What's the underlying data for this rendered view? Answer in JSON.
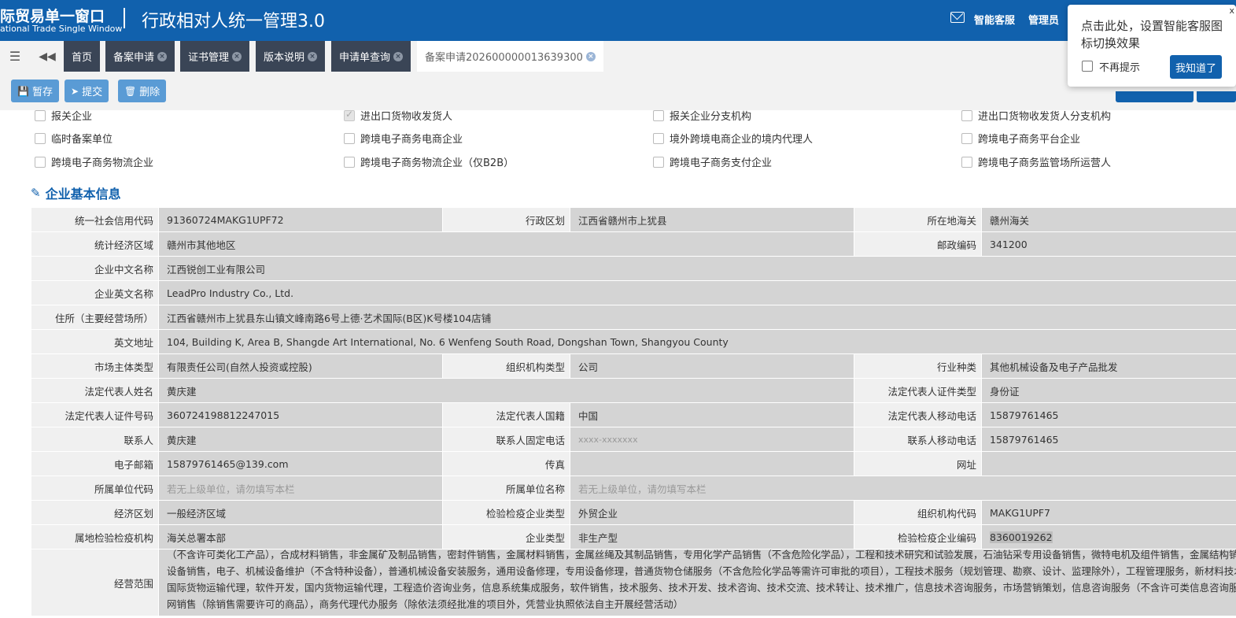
{
  "header": {
    "brand_cn": "际贸易单一窗口",
    "brand_en": "ational Trade Single Window",
    "system_title": "行政相对人统一管理3.0",
    "service_label": "智能客服",
    "admin_label": "管理员"
  },
  "popup": {
    "message": "点击此处，设置智能客服图标切换效果",
    "close": "x",
    "dont_show": "不再提示",
    "ok": "我知道了"
  },
  "tabs": {
    "home": "首页",
    "items": [
      "备案申请",
      "证书管理",
      "版本说明",
      "申请单查询"
    ],
    "active": "备案申请202600000013639300",
    "close_glyph": "×"
  },
  "toolbar": {
    "save": "暂存",
    "submit": "提交",
    "delete": "删除"
  },
  "enterprise_types": [
    {
      "label": "报关企业",
      "checked": false
    },
    {
      "label": "进出口货物收发货人",
      "checked": true
    },
    {
      "label": "报关企业分支机构",
      "checked": false
    },
    {
      "label": "进出口货物收发货人分支机构",
      "checked": false
    },
    {
      "label": "临时备案单位",
      "checked": false
    },
    {
      "label": "跨境电子商务电商企业",
      "checked": false
    },
    {
      "label": "境外跨境电商企业的境内代理人",
      "checked": false
    },
    {
      "label": "跨境电子商务平台企业",
      "checked": false
    },
    {
      "label": "跨境电子商务物流企业",
      "checked": false
    },
    {
      "label": "跨境电子商务物流企业（仅B2B）",
      "checked": false
    },
    {
      "label": "跨境电子商务支付企业",
      "checked": false
    },
    {
      "label": "跨境电子商务监管场所运营人",
      "checked": false
    }
  ],
  "section_title": "企业基本信息",
  "form": {
    "credit_code": {
      "label": "统一社会信用代码",
      "value": "91360724MAKG1UPF72"
    },
    "admin_region": {
      "label": "行政区划",
      "value": "江西省赣州市上犹县"
    },
    "customs": {
      "label": "所在地海关",
      "value": "赣州海关"
    },
    "econ_area": {
      "label": "统计经济区域",
      "value": "赣州市其他地区"
    },
    "postcode": {
      "label": "邮政编码",
      "value": "341200"
    },
    "name_cn": {
      "label": "企业中文名称",
      "value": "江西锐创工业有限公司"
    },
    "name_en": {
      "label": "企业英文名称",
      "value": "LeadPro Industry Co., Ltd."
    },
    "address": {
      "label": "住所（主要经营场所）",
      "value": "江西省赣州市上犹县东山镇文峰南路6号上德·艺术国际(B区)K号楼104店铺"
    },
    "address_en": {
      "label": "英文地址",
      "value": "104, Building K, Area B, Shangde Art International, No. 6 Wenfeng South Road, Dongshan Town, Shangyou County"
    },
    "market_type": {
      "label": "市场主体类型",
      "value": "有限责任公司(自然人投资或控股)"
    },
    "org_type": {
      "label": "组织机构类型",
      "value": "公司"
    },
    "industry": {
      "label": "行业种类",
      "value": "其他机械设备及电子产品批发"
    },
    "legal_name": {
      "label": "法定代表人姓名",
      "value": "黄庆建"
    },
    "legal_id_type": {
      "label": "法定代表人证件类型",
      "value": "身份证"
    },
    "legal_id_no": {
      "label": "法定代表人证件号码",
      "value": "360724198812247015"
    },
    "legal_nation": {
      "label": "法定代表人国籍",
      "value": "中国"
    },
    "legal_mobile": {
      "label": "法定代表人移动电话",
      "value": "15879761465"
    },
    "contact": {
      "label": "联系人",
      "value": "黄庆建"
    },
    "contact_tel": {
      "label": "联系人固定电话",
      "placeholder": "xxxx-xxxxxxx"
    },
    "contact_mobile": {
      "label": "联系人移动电话",
      "value": "15879761465"
    },
    "email": {
      "label": "电子邮箱",
      "value": "15879761465@139.com"
    },
    "fax": {
      "label": "传真",
      "value": ""
    },
    "website": {
      "label": "网址",
      "value": ""
    },
    "parent_code": {
      "label": "所属单位代码",
      "placeholder": "若无上级单位，请勿填写本栏"
    },
    "parent_name": {
      "label": "所属单位名称",
      "placeholder": "若无上级单位，请勿填写本栏"
    },
    "econ_zone": {
      "label": "经济区划",
      "value": "一般经济区域"
    },
    "ciq_type": {
      "label": "检验检疫企业类型",
      "value": "外贸企业"
    },
    "org_code": {
      "label": "组织机构代码",
      "value": "MAKG1UPF7"
    },
    "ciq_org": {
      "label": "属地检验检疫机构",
      "value": "海关总署本部"
    },
    "ent_type": {
      "label": "企业类型",
      "value": "非生产型"
    },
    "ciq_code": {
      "label": "检验检疫企业编码",
      "value": "8360019262"
    },
    "scope": {
      "label": "经营范围",
      "lines": [
        "（不含许可类化工产品），合成材料销售，非金属矿及制品销售，密封件销售，金属材料销售，金属丝绳及其制品销售，专用化学产品销售（不含危险化学品），工程和技术研究和试验发展，石油钻采专用设备销售，微特电机及组件销售，金属结构销售，特",
        "设备销售，电子、机械设备维护（不含特种设备），普通机械设备安装服务，通用设备修理，专用设备修理，普通货物仓储服务（不含危险化学品等需许可审批的项目），工程技术服务（规划管理、勘察、设计、监理除外），工程管理服务，新材料技术研发",
        "国际货物运输代理，软件开发，国内货物运输代理，工程造价咨询业务，信息系统集成服务，软件销售，技术服务、技术开发、技术咨询、技术交流、技术转让、技术推广，信息技术咨询服务，市场营销策划，信息咨询服务（不含许可类信息咨询服务），互",
        "网销售（除销售需要许可的商品），商务代理代办服务（除依法须经批准的项目外，凭营业执照依法自主开展经营活动）"
      ]
    }
  }
}
